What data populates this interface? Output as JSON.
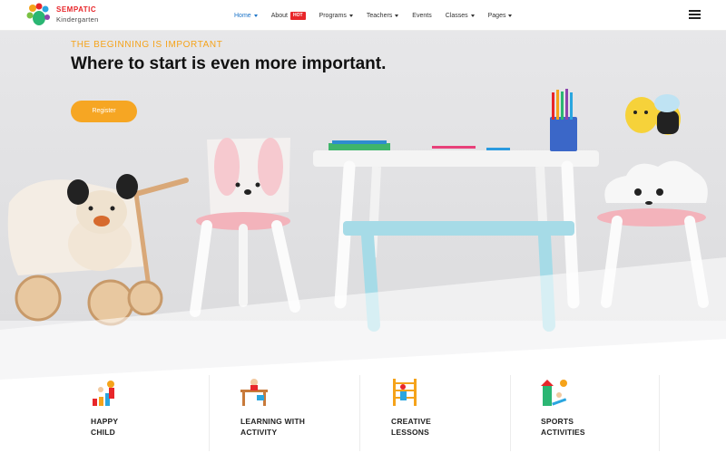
{
  "brand": {
    "logo_line1": "SEMPATIC",
    "logo_line2": "Kindergarten"
  },
  "nav": {
    "items": [
      {
        "label": "Home",
        "active": true,
        "has_caret": true
      },
      {
        "label": "About",
        "badge": "HOT"
      },
      {
        "label": "Programs",
        "has_caret": true
      },
      {
        "label": "Teachers",
        "has_caret": true
      },
      {
        "label": "Events"
      },
      {
        "label": "Classes",
        "has_caret": true
      },
      {
        "label": "Pages",
        "has_caret": true
      }
    ]
  },
  "hero": {
    "eyebrow": "THE BEGINNING IS IMPORTANT",
    "headline": "Where to start is even more important.",
    "register_label": "Register"
  },
  "features": [
    {
      "line1": "HAPPY",
      "line2": "CHILD",
      "icon": "happy-child-icon"
    },
    {
      "line1": "LEARNING WITH",
      "line2": "ACTIVITY",
      "icon": "learning-desk-icon"
    },
    {
      "line1": "CREATIVE",
      "line2": "LESSONS",
      "icon": "creative-easel-icon"
    },
    {
      "line1": "SPORTS",
      "line2": "ACTIVITIES",
      "icon": "sports-playground-icon"
    }
  ],
  "colors": {
    "accent": "#f6a623",
    "nav_active": "#1a73c8",
    "badge": "#e8262a"
  }
}
